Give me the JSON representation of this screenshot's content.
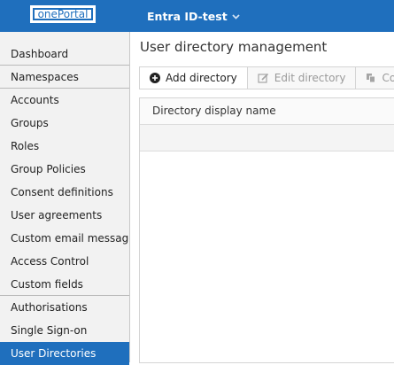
{
  "header": {
    "logo_text": "onePortal",
    "tenant_name": "Entra ID-test"
  },
  "sidebar": {
    "items": [
      {
        "label": "Dashboard"
      },
      {
        "label": "Namespaces"
      },
      {
        "label": "Accounts"
      },
      {
        "label": "Groups"
      },
      {
        "label": "Roles"
      },
      {
        "label": "Group Policies"
      },
      {
        "label": "Consent definitions"
      },
      {
        "label": "User agreements"
      },
      {
        "label": "Custom email messages"
      },
      {
        "label": "Access Control"
      },
      {
        "label": "Custom fields"
      },
      {
        "label": "Authorisations"
      },
      {
        "label": "Single Sign-on"
      },
      {
        "label": "User Directories",
        "active": true
      }
    ]
  },
  "main": {
    "title": "User directory management",
    "toolbar": {
      "add_label": "Add directory",
      "edit_label": "Edit directory",
      "copy_label": "Cop"
    },
    "table": {
      "columns": [
        "Directory display name"
      ]
    }
  },
  "colors": {
    "brand": "#1f6fbd",
    "sidebar_bg": "#f2f2f2"
  }
}
